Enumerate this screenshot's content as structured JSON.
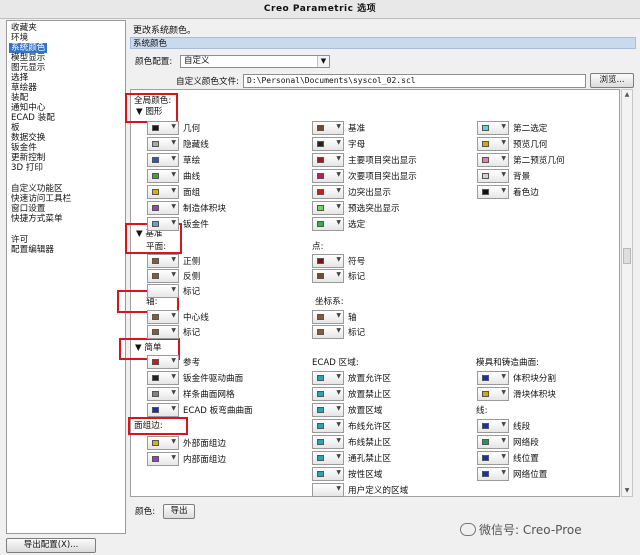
{
  "window": {
    "title": "Creo Parametric 选项"
  },
  "sidebar": {
    "items": [
      {
        "label": "收藏夹",
        "selected": false
      },
      {
        "label": "环境",
        "selected": false
      },
      {
        "label": "系统颜色",
        "selected": true
      },
      {
        "label": "模型显示",
        "selected": false
      },
      {
        "label": "图元显示",
        "selected": false
      },
      {
        "label": "选择",
        "selected": false
      },
      {
        "label": "草绘器",
        "selected": false
      },
      {
        "label": "装配",
        "selected": false
      },
      {
        "label": "通知中心",
        "selected": false
      },
      {
        "label": "ECAD 装配",
        "selected": false
      },
      {
        "label": "板",
        "selected": false
      },
      {
        "label": "数据交换",
        "selected": false
      },
      {
        "label": "钣金件",
        "selected": false
      },
      {
        "label": "更新控制",
        "selected": false
      },
      {
        "label": "3D 打印",
        "selected": false
      },
      {
        "label": "自定义功能区",
        "selected": false
      },
      {
        "label": "快速访问工具栏",
        "selected": false
      },
      {
        "label": "窗口设置",
        "selected": false
      },
      {
        "label": "快捷方式菜单",
        "selected": false
      },
      {
        "label": "许可",
        "selected": false
      },
      {
        "label": "配置编辑器",
        "selected": false
      }
    ]
  },
  "main": {
    "description": "更改系统颜色。",
    "section_title": "系统颜色",
    "scheme_label": "颜色配置:",
    "scheme_value": "自定义",
    "file_label": "自定义颜色文件:",
    "file_path": "D:\\Personal\\Documents\\syscol_02.scl",
    "browse_label": "浏览...",
    "global_colors_label": "全局颜色:",
    "groups": {
      "graphics": "▼ 图形",
      "datum": "▼ 基准",
      "datum_plane": "平面:",
      "datum_point": "点:",
      "datum_axis": "轴:",
      "datum_csys": "坐标系:",
      "simple": "▼ 简单",
      "ecad": "ECAD 区域:",
      "mold": "模具和铸造曲面:",
      "line": "线:",
      "face_edge": "面组边:"
    },
    "graphics_items": [
      {
        "label": "几何",
        "color": "#1a1a1a"
      },
      {
        "label": "隐藏线",
        "color": "#a9a9a9"
      },
      {
        "label": "草绘",
        "color": "#2e57b4"
      },
      {
        "label": "曲线",
        "color": "#3ea04a"
      },
      {
        "label": "面组",
        "color": "#d9b400"
      },
      {
        "label": "制造体积块",
        "color": "#9a3fb8"
      },
      {
        "label": "钣金件",
        "color": "#6f9ad8"
      },
      {
        "label": "基准",
        "color": "#7a4a2a"
      },
      {
        "label": "字母",
        "color": "#222222"
      },
      {
        "label": "主要项目突出显示",
        "color": "#a3161b"
      },
      {
        "label": "次要项目突出显示",
        "color": "#bb1d5a"
      },
      {
        "label": "边突出显示",
        "color": "#d11b1b"
      },
      {
        "label": "预选突出显示",
        "color": "#7ad05a"
      },
      {
        "label": "选定",
        "color": "#2fb04f"
      },
      {
        "label": "第二选定",
        "color": "#5ad5cc"
      },
      {
        "label": "预览几何",
        "color": "#d7a800"
      },
      {
        "label": "第二预览几何",
        "color": "#e87ab0"
      },
      {
        "label": "背景",
        "color": "#cfcfcf"
      },
      {
        "label": "着色边",
        "color": "#111111"
      }
    ],
    "datum_items": [
      {
        "label": "正侧",
        "color": "#8a5a34"
      },
      {
        "label": "反侧",
        "color": "#8a5a34"
      },
      {
        "label": "标记",
        "color": ""
      },
      {
        "label": "符号",
        "color": "#7a1010"
      },
      {
        "label": "标记",
        "color": "#7a4a2a"
      },
      {
        "label": "中心线",
        "color": "#8a5a34"
      },
      {
        "label": "标记",
        "color": "#8a5a34"
      },
      {
        "label": "轴",
        "color": "#8a5a34"
      },
      {
        "label": "标记",
        "color": "#8a5a34"
      }
    ],
    "simple_items": [
      {
        "label": "参考",
        "color": "#cc1a1a"
      },
      {
        "label": "钣金件驱动曲面",
        "color": "#222222"
      },
      {
        "label": "样条曲面网格",
        "color": "#808080"
      },
      {
        "label": "ECAD 板弯曲曲面",
        "color": "#1a2fb0"
      },
      {
        "label": "放置允许区",
        "color": "#2aa5b0"
      },
      {
        "label": "放置禁止区",
        "color": "#2aa5b0"
      },
      {
        "label": "放置区域",
        "color": "#2aa5b0"
      },
      {
        "label": "布线允许区",
        "color": "#2aa5b0"
      },
      {
        "label": "布线禁止区",
        "color": "#2aa5b0"
      },
      {
        "label": "通孔禁止区",
        "color": "#2aa5b0"
      },
      {
        "label": "按性区域",
        "color": "#2aa5b0"
      },
      {
        "label": "用户定义的区域",
        "color": ""
      },
      {
        "label": "体积块分割",
        "color": "#1a2fb0"
      },
      {
        "label": "滑块体积块",
        "color": "#d9a800"
      },
      {
        "label": "线段",
        "color": "#1a2fb0"
      },
      {
        "label": "网络段",
        "color": "#1f9a55"
      },
      {
        "label": "线位置",
        "color": "#1a2fb0"
      },
      {
        "label": "网络位置",
        "color": "#1a2fb0"
      },
      {
        "label": "外部面组边",
        "color": "#d9b400"
      },
      {
        "label": "内部面组边",
        "color": "#9a3fb8"
      }
    ],
    "bottom_color_label": "颜色:",
    "export_label": "导出"
  },
  "footer": {
    "export_config_label": "导出配置(X)..."
  },
  "watermark": "微信号: Creo-Proe"
}
